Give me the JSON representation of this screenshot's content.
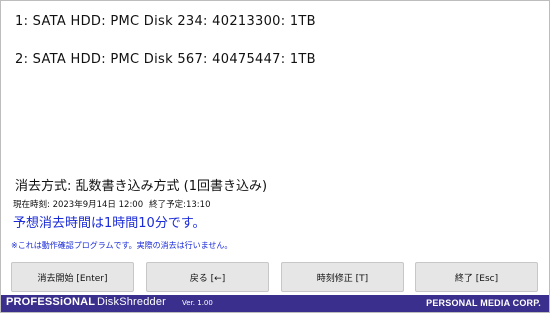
{
  "disks": [
    {
      "label": "1: SATA HDD: PMC Disk 234: 40213300: 1TB"
    },
    {
      "label": "2: SATA HDD: PMC Disk 567: 40475447: 1TB"
    }
  ],
  "method": {
    "label": "消去方式: 乱数書き込み方式 (1回書き込み)"
  },
  "times": {
    "current": "現在時刻: 2023年9月14日 12:00",
    "planned_end": "終了予定:13:10"
  },
  "estimate": {
    "text": "予想消去時間は1時間10分です。"
  },
  "notice": {
    "text": "※これは動作確認プログラムです。実際の消去は行いません。"
  },
  "buttons": {
    "start": "消去開始 [Enter]",
    "back": "戻る [←]",
    "time_fix": "時刻修正 [T]",
    "exit": "終了 [Esc]"
  },
  "footer": {
    "brand": "PROFESSiONAL",
    "product": "DiskShredder",
    "version": "Ver. 1.00",
    "company": "PERSONAL MEDIA CORP."
  },
  "colors": {
    "footer_bg": "#3a2f8c",
    "info_text": "#1a2bd6",
    "button_bg": "#e6e6e6"
  }
}
